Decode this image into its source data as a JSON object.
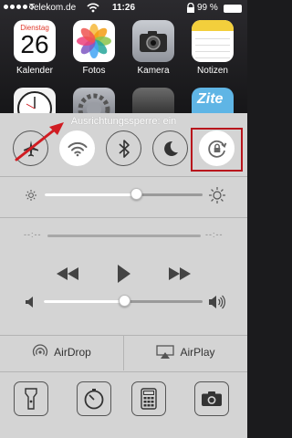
{
  "status_bar": {
    "carrier": "Telekom.de",
    "time": "11:26",
    "battery_text": "99 %",
    "battery_level": 0.99
  },
  "home_apps": [
    {
      "label": "Kalender",
      "weekday": "Dienstag",
      "day": "26"
    },
    {
      "label": "Fotos"
    },
    {
      "label": "Kamera"
    },
    {
      "label": "Notizen"
    }
  ],
  "home_row2_partial": [
    "Uhr",
    "Einstellungen",
    "Passbook",
    "Zite"
  ],
  "control_center": {
    "status_banner": "Ausrichtungssperre: ein",
    "toggles": [
      {
        "name": "airplane-mode",
        "on": false
      },
      {
        "name": "wifi",
        "on": true
      },
      {
        "name": "bluetooth",
        "on": false
      },
      {
        "name": "do-not-disturb",
        "on": false
      },
      {
        "name": "orientation-lock",
        "on": true
      }
    ],
    "brightness_level": 0.58,
    "music": {
      "elapsed": "--:--",
      "remaining": "--:--",
      "progress": 0
    },
    "volume_level": 0.51,
    "airdrop_label": "AirDrop",
    "airplay_label": "AirPlay",
    "shortcuts": [
      "flashlight-icon",
      "timer-icon",
      "calculator-icon",
      "camera-icon"
    ]
  },
  "colors": {
    "highlight": "#b8151c",
    "arrow": "#d01c22",
    "panel": "#d4d4d4"
  }
}
